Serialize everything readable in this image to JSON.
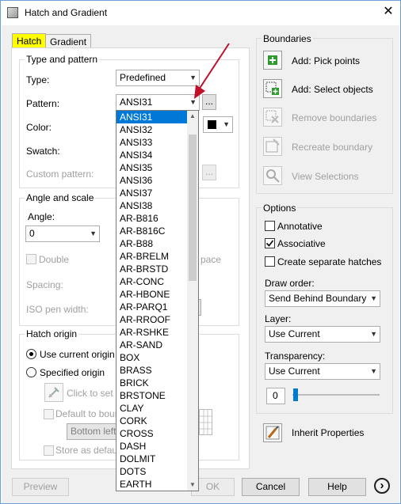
{
  "window": {
    "title": "Hatch and Gradient"
  },
  "tabs": [
    {
      "label": "Hatch",
      "active": true
    },
    {
      "label": "Gradient",
      "active": false
    }
  ],
  "type_pattern": {
    "group_label": "Type and pattern",
    "type_label": "Type:",
    "type_value": "Predefined",
    "pattern_label": "Pattern:",
    "pattern_value": "ANSI31",
    "browse_label": "...",
    "color_label": "Color:",
    "swatch_label": "Swatch:",
    "custom_pattern_label": "Custom pattern:",
    "custom_browse_label": "..."
  },
  "angle_scale": {
    "group_label": "Angle and scale",
    "angle_label": "Angle:",
    "angle_value": "0",
    "double_label": "Double",
    "space_fragment": "pace",
    "spacing_label": "Spacing:",
    "iso_pen_label": "ISO pen width:"
  },
  "hatch_origin": {
    "group_label": "Hatch origin",
    "use_current_label": "Use current origin",
    "specified_label": "Specified origin",
    "click_to_set_label": "Click to set ne",
    "default_to_boundary_label": "Default to bound",
    "bottom_left_label": "Bottom left",
    "store_default_label": "Store as default c"
  },
  "pattern_dropdown": {
    "items": [
      "ANSI31",
      "ANSI32",
      "ANSI33",
      "ANSI34",
      "ANSI35",
      "ANSI36",
      "ANSI37",
      "ANSI38",
      "AR-B816",
      "AR-B816C",
      "AR-B88",
      "AR-BRELM",
      "AR-BRSTD",
      "AR-CONC",
      "AR-HBONE",
      "AR-PARQ1",
      "AR-RROOF",
      "AR-RSHKE",
      "AR-SAND",
      "BOX",
      "BRASS",
      "BRICK",
      "BRSTONE",
      "CLAY",
      "CORK",
      "CROSS",
      "DASH",
      "DOLMIT",
      "DOTS",
      "EARTH"
    ],
    "selected": "ANSI31"
  },
  "boundaries": {
    "group_label": "Boundaries",
    "add_pick_points": "Add: Pick points",
    "add_select_objects": "Add: Select objects",
    "remove_boundaries": "Remove boundaries",
    "recreate_boundary": "Recreate boundary",
    "view_selections": "View Selections"
  },
  "options": {
    "group_label": "Options",
    "annotative_label": "Annotative",
    "annotative_checked": false,
    "associative_label": "Associative",
    "associative_checked": true,
    "separate_hatches_label": "Create separate hatches",
    "separate_hatches_checked": false,
    "draw_order_label": "Draw order:",
    "draw_order_value": "Send Behind Boundary",
    "layer_label": "Layer:",
    "layer_value": "Use Current",
    "transparency_label": "Transparency:",
    "transparency_value": "Use Current",
    "transparency_amount": "0"
  },
  "inherit_properties_label": "Inherit Properties",
  "footer": {
    "preview_label": "Preview",
    "ok_fragment": "OK",
    "cancel_label": "Cancel",
    "help_label": "Help",
    "more_label": "›"
  },
  "colors": {
    "tab_highlight": "#ffff00",
    "selection": "#0078d7",
    "arrow": "#c0102a",
    "slider": "#007acc"
  }
}
